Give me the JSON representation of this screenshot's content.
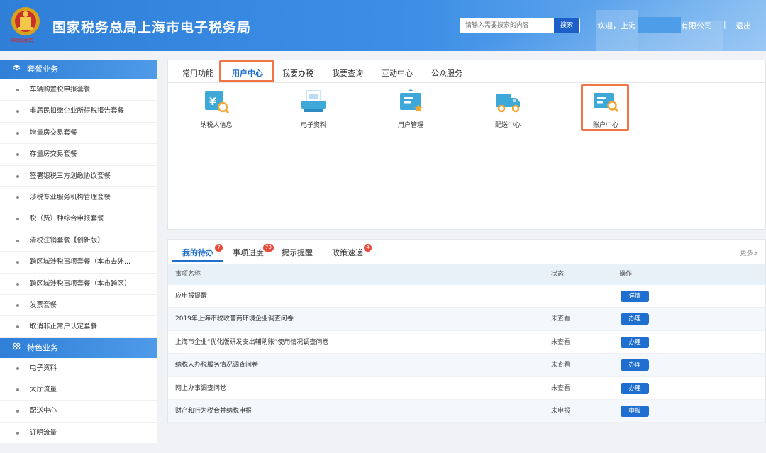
{
  "header": {
    "title": "国家税务总局上海市电子税务局",
    "emblem_caption": "中国税务",
    "search_placeholder": "请输入需要搜索的内容",
    "search_button": "搜索",
    "welcome": "欢迎，上海",
    "company": "有限公司",
    "separator": "|",
    "logout": "退出"
  },
  "sidebar": {
    "section1": {
      "title": "套餐业务",
      "icon": "layers-icon",
      "items": [
        "车辆购置税申报套餐",
        "非居民扣缴企业所得税报告套餐",
        "增量房交易套餐",
        "存量房交易套餐",
        "签署银税三方划缴协议套餐",
        "涉税专业服务机构管理套餐",
        "税（费）种综合申报套餐",
        "清税注销套餐【创新版】",
        "跨区域涉税事项套餐（本市去外...",
        "跨区域涉税事项套餐（本市跨区）",
        "发票套餐",
        "取消非正常户认定套餐"
      ]
    },
    "section2": {
      "title": "特色业务",
      "icon": "grid-icon",
      "items": [
        "电子资料",
        "大厅流量",
        "配送中心",
        "证明流量"
      ]
    }
  },
  "top_panel": {
    "tabs": [
      "常用功能",
      "用户中心",
      "我要办税",
      "我要查询",
      "互动中心",
      "公众服务"
    ],
    "active_tab": "用户中心",
    "tiles": [
      {
        "label": "纳税人信息",
        "icon": "taxpayer-info-icon"
      },
      {
        "label": "电子资料",
        "icon": "electronic-docs-icon"
      },
      {
        "label": "用户管理",
        "icon": "user-management-icon"
      },
      {
        "label": "配送中心",
        "icon": "delivery-truck-icon"
      },
      {
        "label": "账户中心",
        "icon": "account-center-icon"
      }
    ]
  },
  "bottom_panel": {
    "tabs": [
      {
        "label": "我的待办",
        "badge": "7"
      },
      {
        "label": "事项进度",
        "badge": "73"
      },
      {
        "label": "提示提醒",
        "badge": ""
      },
      {
        "label": "政策速递",
        "badge": "4"
      }
    ],
    "more": "更多>",
    "columns": [
      "事项名称",
      "状态",
      "操作"
    ],
    "rows": [
      {
        "name": "应申报提醒",
        "status": "",
        "action": "详情"
      },
      {
        "name": "2019年上海市税收营商环境企业调查问卷",
        "status": "未查看",
        "action": "办理"
      },
      {
        "name": "上海市企业“优化版研发支出辅助账”使用情况调查问卷",
        "status": "未查看",
        "action": "办理"
      },
      {
        "name": "纳税人办税服务情况调查问卷",
        "status": "未查看",
        "action": "办理"
      },
      {
        "name": "网上办事调查问卷",
        "status": "未查看",
        "action": "办理"
      },
      {
        "name": "财产和行为税合并纳税申报",
        "status": "未申报",
        "action": "申报"
      }
    ]
  },
  "colors": {
    "primary": "#1f6fd1",
    "highlight": "#f07444",
    "badge": "#e84b3c"
  }
}
